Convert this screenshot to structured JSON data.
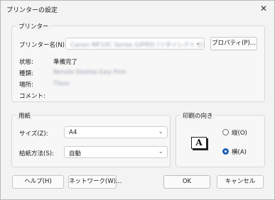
{
  "window": {
    "title": "プリンターの設定",
    "close_glyph": "✕"
  },
  "printer_group": {
    "label": "プリンター",
    "name_label": "プリンター名(N):",
    "name_value": "Canon MF10C Series (UFRII) (リダイレクト 2)",
    "properties_button": "プロパティ(P)...",
    "status_label": "状態:",
    "status_value": "準備完了",
    "type_label": "種類:",
    "type_value": "Remote Desktop Easy Print",
    "location_label": "場所:",
    "location_value": "TSxxx",
    "comment_label": "コメント:",
    "comment_value": ""
  },
  "paper_group": {
    "label": "用紙",
    "size_label": "サイズ(Z):",
    "size_value": "A4",
    "source_label": "給紙方法(S):",
    "source_value": "自動"
  },
  "orientation_group": {
    "label": "印刷の向き",
    "icon_glyph": "A",
    "portrait_label": "縦(O)",
    "landscape_label": "横(A)",
    "selected": "landscape"
  },
  "buttons": {
    "help": "ヘルプ(H)",
    "network": "ネットワーク(W)...",
    "ok": "OK",
    "cancel": "キャンセル"
  },
  "icons": {
    "dropdown": "chevron-down-icon",
    "close": "close-icon"
  }
}
